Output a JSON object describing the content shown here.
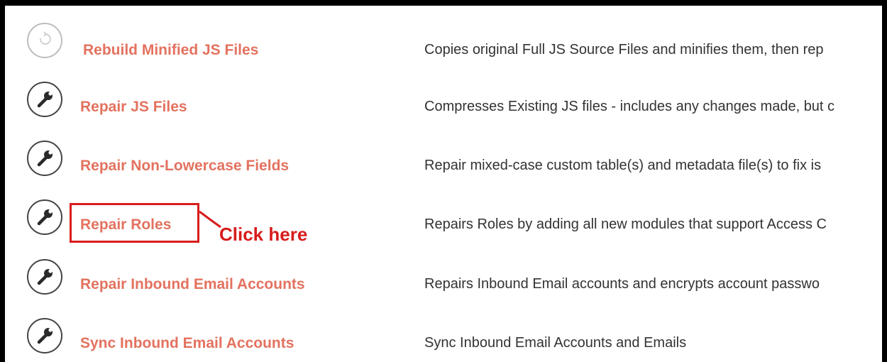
{
  "rows": [
    {
      "icon": "refresh-icon",
      "title": "Rebuild Minified JS Files",
      "description": "Copies original Full JS Source Files and minifies them, then rep"
    },
    {
      "icon": "wrench-icon",
      "title": "Repair JS Files",
      "description": "Compresses Existing JS files - includes any changes made, but c"
    },
    {
      "icon": "wrench-icon",
      "title": "Repair Non-Lowercase Fields",
      "description": "Repair mixed-case custom table(s) and metadata file(s) to fix is"
    },
    {
      "icon": "wrench-icon",
      "title": "Repair Roles",
      "description": "Repairs Roles by adding all new modules that support Access C"
    },
    {
      "icon": "wrench-icon",
      "title": "Repair Inbound Email Accounts",
      "description": "Repairs Inbound Email accounts and encrypts account passwo"
    },
    {
      "icon": "wrench-icon",
      "title": "Sync Inbound Email Accounts",
      "description": "Sync Inbound Email Accounts and Emails"
    }
  ],
  "annotation": {
    "callout_text": "Click here",
    "color": "#d81c1c"
  },
  "colors": {
    "link": "#e3725f",
    "description": "#333333",
    "border": "#000000"
  }
}
